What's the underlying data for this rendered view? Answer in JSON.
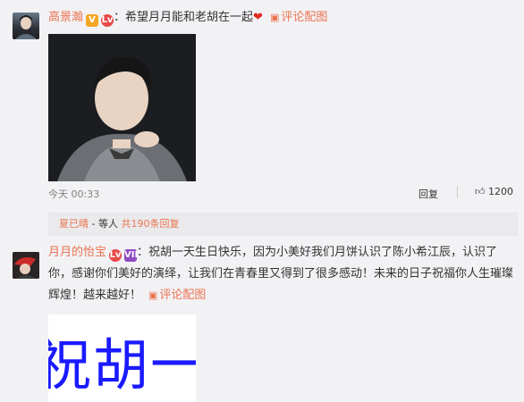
{
  "comments": [
    {
      "user": "高景瀚",
      "badges": [
        "V",
        "Lv"
      ],
      "text": "：希望月月能和老胡在一起",
      "heart": "❤",
      "pic_link": "评论配图",
      "time": "今天 00:33",
      "reply": "回复",
      "likes": "1200",
      "sub_user": "夏已晴",
      "sub_text": "- 等人",
      "sub_more": "共190条回复"
    },
    {
      "user": "月月的怡宝",
      "badges": [
        "Lv",
        "VIP"
      ],
      "text": "：祝胡一天生日快乐，因为小美好我们月饼认识了陈小希江辰，认识了你，感谢你们美好的演绎，让我们在青春里又得到了很多感动！未来的日子祝福你人生璀璨辉煌！越来越好！",
      "pic_link": "评论配图",
      "image_text": "祝胡一天"
    }
  ],
  "icons": {
    "pic": "image-icon",
    "like": "thumbs-up-icon"
  },
  "colors": {
    "accent": "#eb7350",
    "heart": "#e3281f",
    "background": "#f2f2f5"
  }
}
